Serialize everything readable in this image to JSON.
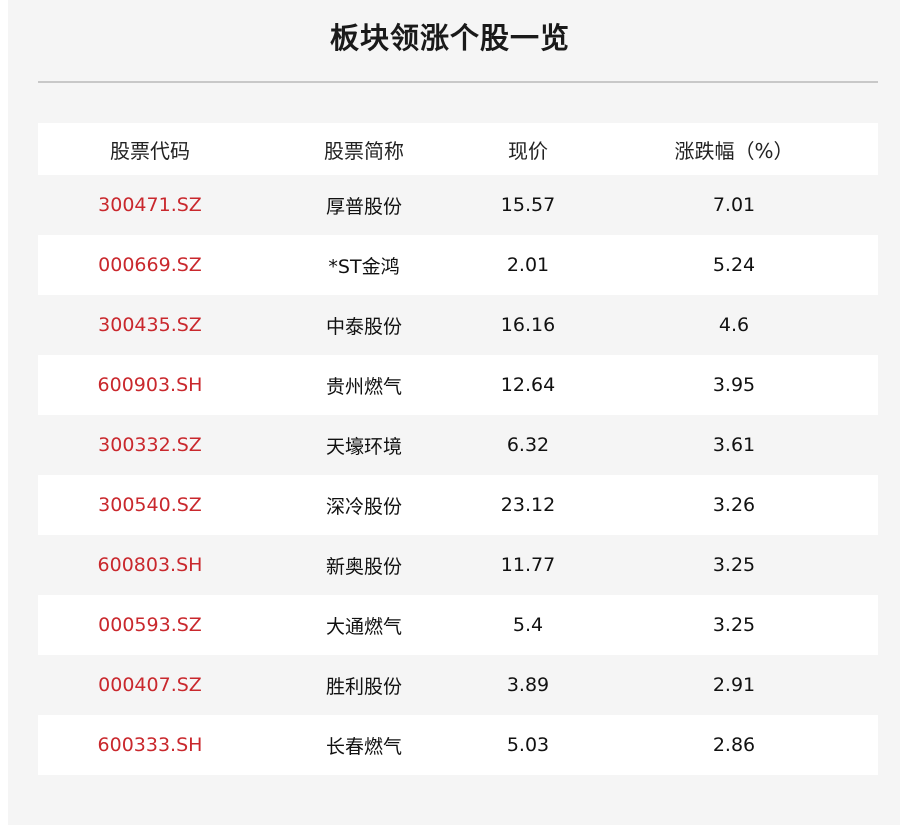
{
  "title": "板块领涨个股一览",
  "colors": {
    "code_red": "#c9282d",
    "panel_bg": "#f5f5f5",
    "row_alt_bg": "#ffffff"
  },
  "table": {
    "headers": [
      "股票代码",
      "股票简称",
      "现价",
      "涨跌幅（%）"
    ],
    "rows": [
      {
        "code": "300471.SZ",
        "name": "厚普股份",
        "price": "15.57",
        "change": "7.01"
      },
      {
        "code": "000669.SZ",
        "name": "*ST金鸿",
        "price": "2.01",
        "change": "5.24"
      },
      {
        "code": "300435.SZ",
        "name": "中泰股份",
        "price": "16.16",
        "change": "4.6"
      },
      {
        "code": "600903.SH",
        "name": "贵州燃气",
        "price": "12.64",
        "change": "3.95"
      },
      {
        "code": "300332.SZ",
        "name": "天壕环境",
        "price": "6.32",
        "change": "3.61"
      },
      {
        "code": "300540.SZ",
        "name": "深冷股份",
        "price": "23.12",
        "change": "3.26"
      },
      {
        "code": "600803.SH",
        "name": "新奥股份",
        "price": "11.77",
        "change": "3.25"
      },
      {
        "code": "000593.SZ",
        "name": "大通燃气",
        "price": "5.4",
        "change": "3.25"
      },
      {
        "code": "000407.SZ",
        "name": "胜利股份",
        "price": "3.89",
        "change": "2.91"
      },
      {
        "code": "600333.SH",
        "name": "长春燃气",
        "price": "5.03",
        "change": "2.86"
      }
    ]
  }
}
